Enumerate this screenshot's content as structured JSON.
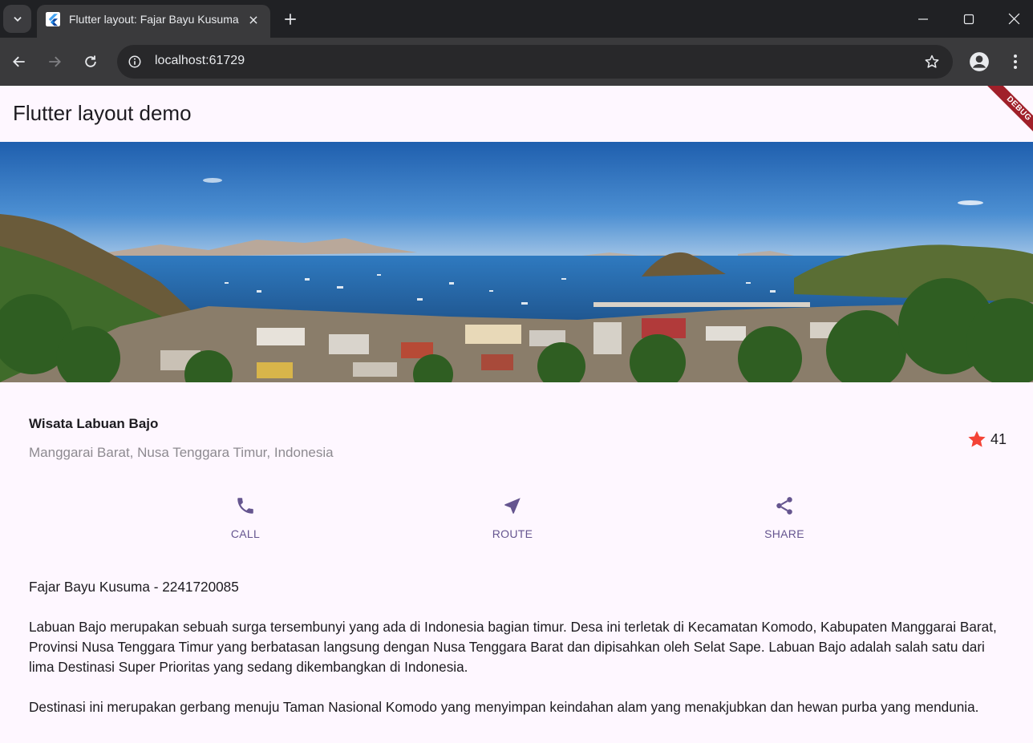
{
  "browser": {
    "tab_title": "Flutter layout: Fajar Bayu Kusuma",
    "url": "localhost:61729"
  },
  "app": {
    "title": "Flutter layout demo",
    "debug_label": "DEBUG"
  },
  "place": {
    "title": "Wisata Labuan Bajo",
    "location": "Manggarai Barat, Nusa Tenggara Timur, Indonesia",
    "rating_count": "41"
  },
  "actions": [
    {
      "label": "CALL",
      "icon": "phone-icon"
    },
    {
      "label": "ROUTE",
      "icon": "near-me-icon"
    },
    {
      "label": "SHARE",
      "icon": "share-icon"
    }
  ],
  "body": {
    "author": "Fajar Bayu Kusuma - 2241720085",
    "paragraph_1": "Labuan Bajo merupakan sebuah surga tersembunyi yang ada di Indonesia bagian timur. Desa ini terletak di Kecamatan Komodo, Kabupaten Manggarai Barat, Provinsi Nusa Tenggara Timur yang berbatasan langsung dengan Nusa Tenggara Barat dan dipisahkan oleh Selat Sape. Labuan Bajo adalah salah satu dari lima Destinasi Super Prioritas yang sedang dikembangkan di Indonesia.",
    "paragraph_2": "Destinasi ini merupakan gerbang menuju Taman Nasional Komodo yang menyimpan keindahan alam yang menakjubkan dan hewan purba yang mendunia."
  },
  "colors": {
    "accent": "#65558f",
    "star": "#f44336",
    "background": "#fef7ff"
  }
}
